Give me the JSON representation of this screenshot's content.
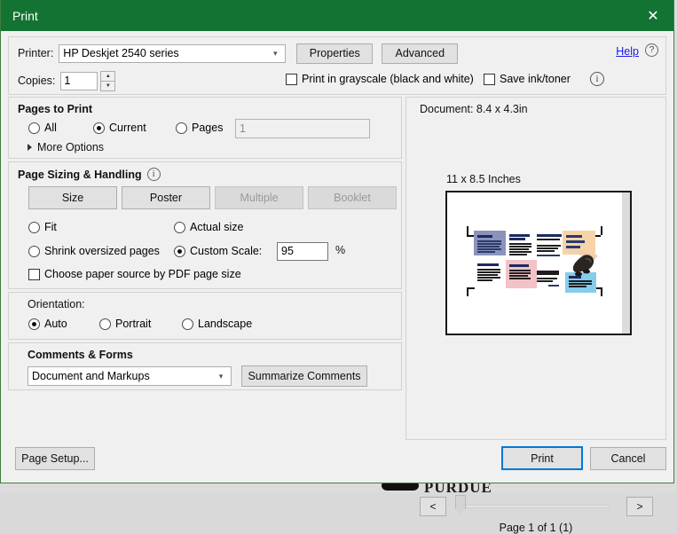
{
  "window": {
    "title": "Print",
    "close_icon": "close-icon",
    "titlebar_color": "#137333"
  },
  "printer": {
    "label": "Printer:",
    "value": "HP Deskjet 2540 series",
    "dropdown_icon": "chevron-down-icon",
    "properties_label": "Properties",
    "advanced_label": "Advanced",
    "help_label": "Help",
    "help_icon": "question-circle-icon",
    "help_color": "#1a1ae6"
  },
  "copies": {
    "label": "Copies:",
    "value": "1",
    "spinner_up_icon": "caret-up-icon",
    "spinner_down_icon": "caret-down-icon"
  },
  "options": {
    "grayscale_label": "Print in grayscale (black and white)",
    "grayscale_checked": false,
    "save_ink_label": "Save ink/toner",
    "save_ink_checked": false,
    "info_icon": "info-circle-icon"
  },
  "pages_to_print": {
    "title": "Pages to Print",
    "all_label": "All",
    "current_label": "Current",
    "pages_label": "Pages",
    "selected": "Current",
    "pages_input_value": "1",
    "more_options_label": "More Options",
    "more_options_icon": "triangle-right-icon"
  },
  "page_sizing": {
    "title": "Page Sizing & Handling",
    "info_icon": "info-circle-icon",
    "buttons": [
      {
        "label": "Size",
        "enabled": true
      },
      {
        "label": "Poster",
        "enabled": true
      },
      {
        "label": "Multiple",
        "enabled": false
      },
      {
        "label": "Booklet",
        "enabled": false
      }
    ],
    "fit_label": "Fit",
    "actual_size_label": "Actual size",
    "shrink_label": "Shrink oversized pages",
    "custom_scale_label": "Custom Scale:",
    "selected": "Custom Scale",
    "scale_value": "95",
    "percent_sign": "%",
    "paper_source_label": "Choose paper source by PDF page size",
    "paper_source_checked": false
  },
  "orientation": {
    "title": "Orientation:",
    "auto_label": "Auto",
    "portrait_label": "Portrait",
    "landscape_label": "Landscape",
    "selected": "Auto"
  },
  "comments_forms": {
    "title": "Comments & Forms",
    "value": "Document and Markups",
    "dropdown_icon": "chevron-down-icon",
    "summarize_label": "Summarize Comments"
  },
  "preview": {
    "document_size": "Document: 8.4 x 4.3in",
    "paper_size": "11 x 8.5 Inches",
    "page_count": "Page 1 of 1 (1)",
    "prev_label": "<",
    "next_label": ">",
    "blocks": [
      {
        "name": "periwinkle-block",
        "color": "#8b92bc"
      },
      {
        "name": "pink-block",
        "color": "#f2c2c6"
      },
      {
        "name": "peach-block",
        "color": "#f7d4a8"
      },
      {
        "name": "lightblue-block",
        "color": "#86cdea"
      }
    ]
  },
  "footer": {
    "page_setup_label": "Page Setup...",
    "print_label": "Print",
    "cancel_label": "Cancel",
    "print_focus_color": "#0078d7"
  },
  "background": {
    "logo_text": "PURDUE"
  }
}
